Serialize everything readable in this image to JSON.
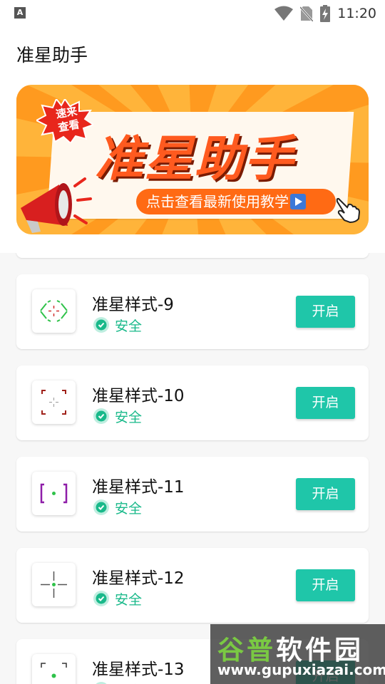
{
  "status_bar": {
    "left_icon": "A",
    "time": "11:20",
    "icons": [
      "wifi-icon",
      "no-sim-icon",
      "battery-charging-icon"
    ]
  },
  "app_bar": {
    "title": "准星助手"
  },
  "banner": {
    "stamp_line1": "速来",
    "stamp_line2": "查看",
    "headline": "准星助手",
    "cta": "点击查看最新使用教学",
    "colors": {
      "background": "#ffb43a",
      "headline": "#ff5a1f",
      "pill": "#ff6a14"
    }
  },
  "crosshairs": [
    {
      "name": "准星样式-9",
      "status": "安全",
      "button": "开启",
      "icon": "crosshair-9-icon",
      "color": "#2fc24a"
    },
    {
      "name": "准星样式-10",
      "status": "安全",
      "button": "开启",
      "icon": "crosshair-10-icon",
      "color": "#a0221b"
    },
    {
      "name": "准星样式-11",
      "status": "安全",
      "button": "开启",
      "icon": "crosshair-11-icon",
      "color": "#8e1da8"
    },
    {
      "name": "准星样式-12",
      "status": "安全",
      "button": "开启",
      "icon": "crosshair-12-icon",
      "color": "#555555"
    },
    {
      "name": "准星样式-13",
      "status": "安全",
      "button": "开启",
      "icon": "crosshair-13-icon",
      "color": "#2fc24a"
    }
  ],
  "watermark": {
    "line1_green": "谷普",
    "line1_white": "软件园",
    "line2": "www.gupuxiazai.com"
  },
  "colors": {
    "accent": "#1fc6a9",
    "safe": "#19b98a"
  }
}
